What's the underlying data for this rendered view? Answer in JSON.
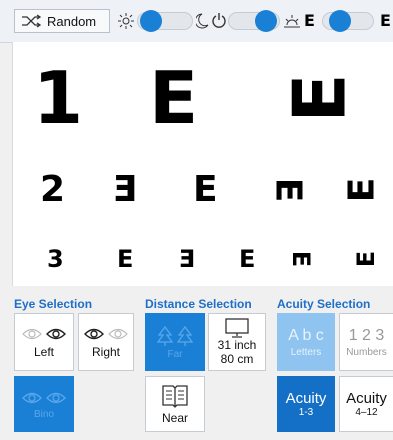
{
  "toolbar": {
    "random_label": "Random"
  },
  "chart": {
    "rows": [
      {
        "number": "1",
        "letters": [
          "E",
          "E"
        ]
      },
      {
        "number": "2",
        "letters": [
          "E",
          "E",
          "E",
          "E"
        ]
      },
      {
        "number": "3",
        "letters": [
          "E",
          "E",
          "E",
          "E",
          "E"
        ]
      }
    ]
  },
  "eye": {
    "title": "Eye Selection",
    "left": "Left",
    "right": "Right",
    "bino": "Bino"
  },
  "distance": {
    "title": "Distance Selection",
    "far": "Far",
    "near": "Near",
    "monitor_line1": "31 inch",
    "monitor_line2": "80 cm"
  },
  "acuity": {
    "title": "Acuity Selection",
    "letters_sample": "A b c",
    "letters": "Letters",
    "numbers_sample": "1 2 3",
    "numbers": "Numbers",
    "acuity_label": "Acuity",
    "range_low": "1-3",
    "range_high": "4–12"
  },
  "colors": {
    "accent": "#1a80d6",
    "section_title": "#1e6fc8",
    "selected_soft": "#8ec4ef"
  }
}
